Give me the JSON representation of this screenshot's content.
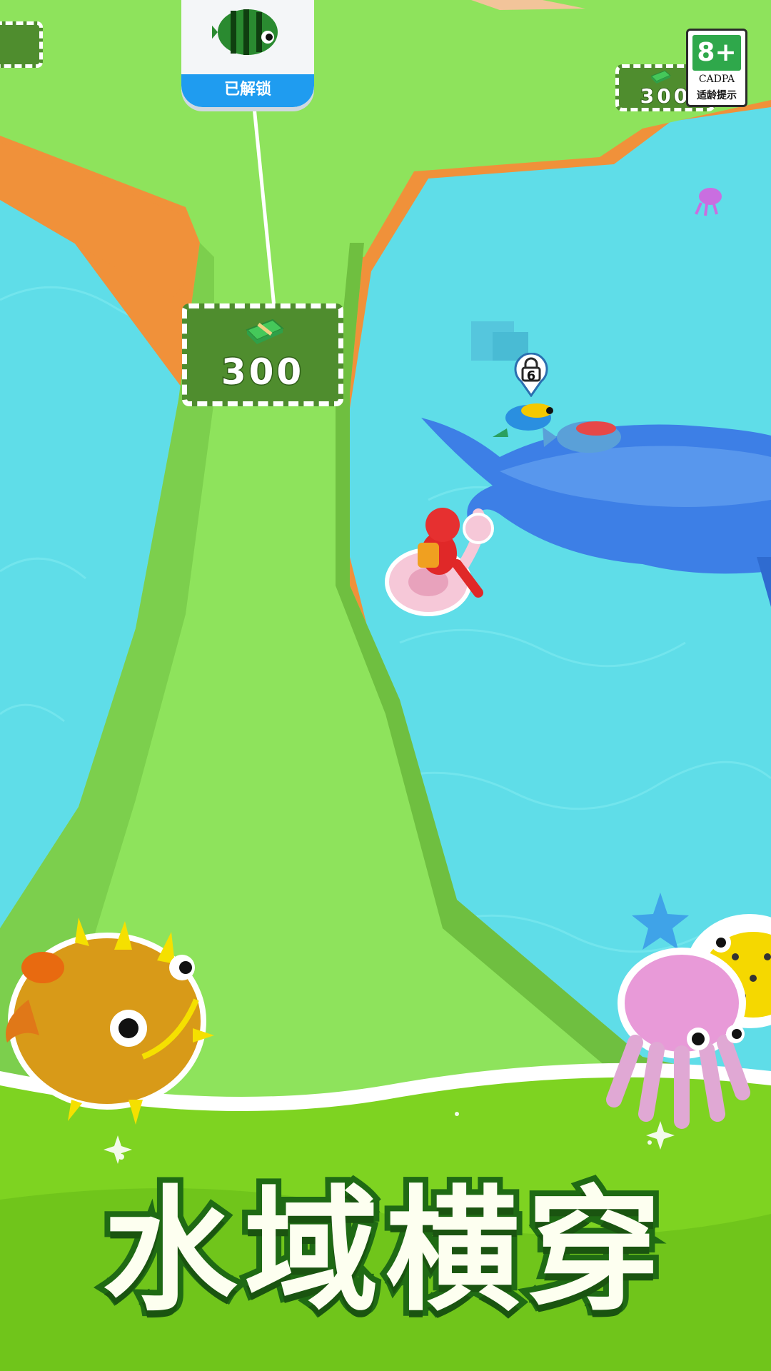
{
  "unlock_card": {
    "status": "已解锁"
  },
  "price_pads": [
    {
      "amount": "300"
    },
    {
      "amount": "300"
    }
  ],
  "age_rating": {
    "age": "8+",
    "org": "CADPA",
    "note": "适龄提示"
  },
  "lock_marker": {
    "level": "6"
  },
  "title": "水域横穿",
  "colors": {
    "water": "#5fdde8",
    "land": "#8ee35c",
    "cliff": "#f0913a",
    "title_stroke": "#1f6a14",
    "banner": "#7ed321"
  }
}
